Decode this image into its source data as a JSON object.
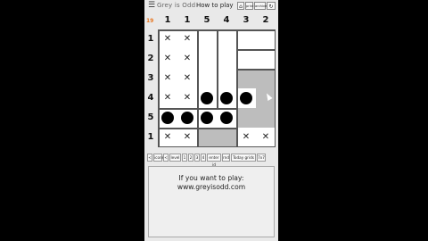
{
  "topbar": {
    "title": "Grey is Odd",
    "how_to_play": "How to play",
    "buttons": [
      "⌂",
      "print",
      "archive",
      "↻"
    ]
  },
  "puzzle": {
    "corner_label": "19",
    "column_clues": [
      "1",
      "1",
      "5",
      "4",
      "3",
      "2"
    ],
    "row_clues": [
      "1",
      "2",
      "3",
      "4",
      "5",
      "1"
    ],
    "rows": [
      [
        "x",
        "x",
        "",
        "",
        "",
        ""
      ],
      [
        "x",
        "x",
        "",
        "",
        "",
        ""
      ],
      [
        "x",
        "x",
        "",
        "",
        "g",
        "g"
      ],
      [
        "x",
        "x",
        "dot",
        "dot",
        "dot",
        "g"
      ],
      [
        "dot",
        "dot",
        "dot",
        "dot",
        "g",
        "g"
      ],
      [
        "x",
        "x",
        "g",
        "g",
        "x",
        "x"
      ]
    ]
  },
  "toolbar": {
    "buttons": [
      "<",
      "icons",
      "<",
      "level",
      "1",
      "2",
      "3",
      "4",
      "enter id",
      "rnd",
      "Today grids",
      "7x7"
    ]
  },
  "info": {
    "line1": "If you want to play:",
    "line2": "www.greyisodd.com"
  }
}
